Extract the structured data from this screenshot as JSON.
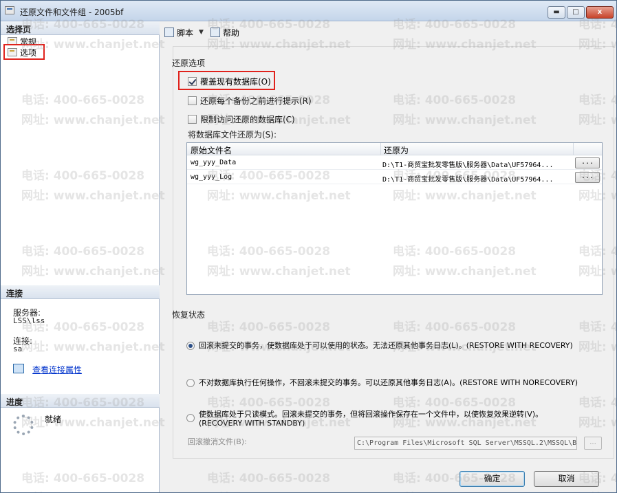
{
  "window": {
    "title": "还原文件和文件组 - 2005bf",
    "min_label": "▬",
    "max_label": "□",
    "close_label": "x"
  },
  "left": {
    "select_page_header": "选择页",
    "pages": [
      {
        "label": "常规",
        "selected": false
      },
      {
        "label": "选项",
        "selected": true
      }
    ],
    "connection_header": "连接",
    "server_label": "服务器:",
    "server_value": "LSS\\lss",
    "connection_label": "连接:",
    "connection_value": "sa",
    "view_connection_link": "查看连接属性",
    "progress_header": "进度",
    "progress_status": "就绪"
  },
  "toolbar": {
    "script_label": "脚本",
    "help_label": "帮助"
  },
  "restore_options": {
    "title": "还原选项",
    "checkboxes": [
      {
        "label": "覆盖现有数据库(O)",
        "checked": true
      },
      {
        "label": "还原每个备份之前进行提示(R)",
        "checked": false
      },
      {
        "label": "限制访问还原的数据库(C)",
        "checked": false
      }
    ],
    "restore_as_label": "将数据库文件还原为(S):",
    "grid": {
      "columns": [
        "原始文件名",
        "还原为"
      ],
      "rows": [
        {
          "original": "wg_yyy_Data",
          "restore_as": "D:\\T1-商贸宝批发零售版\\服务器\\Data\\UF57964...",
          "browse": "..."
        },
        {
          "original": "wg_yyy_Log",
          "restore_as": "D:\\T1-商贸宝批发零售版\\服务器\\Data\\UF57964...",
          "browse": "..."
        }
      ]
    }
  },
  "recovery_state": {
    "title": "恢复状态",
    "options": [
      {
        "label": "回滚未提交的事务，使数据库处于可以使用的状态。无法还原其他事务日志(L)。(RESTORE WITH RECOVERY)",
        "selected": true
      },
      {
        "label": "不对数据库执行任何操作，不回滚未提交的事务。可以还原其他事务日志(A)。(RESTORE WITH NORECOVERY)",
        "selected": false
      },
      {
        "label": "使数据库处于只读模式。回滚未提交的事务，但将回滚操作保存在一个文件中，以使恢复效果逆转(V)。",
        "label2": "(RECOVERY WITH STANDBY)",
        "selected": false
      }
    ],
    "undo_file_label": "回滚撤消文件(B):",
    "undo_file_value": "C:\\Program Files\\Microsoft SQL Server\\MSSQL.2\\MSSQL\\B",
    "undo_browse": "..."
  },
  "footer": {
    "ok_label": "确定",
    "cancel_label": "取消"
  },
  "watermark": {
    "phone": "电话: 400-665-0028",
    "site": "网址: www.chanjet.net"
  },
  "colors": {
    "highlight": "#e0221c",
    "link": "#0033cc"
  }
}
